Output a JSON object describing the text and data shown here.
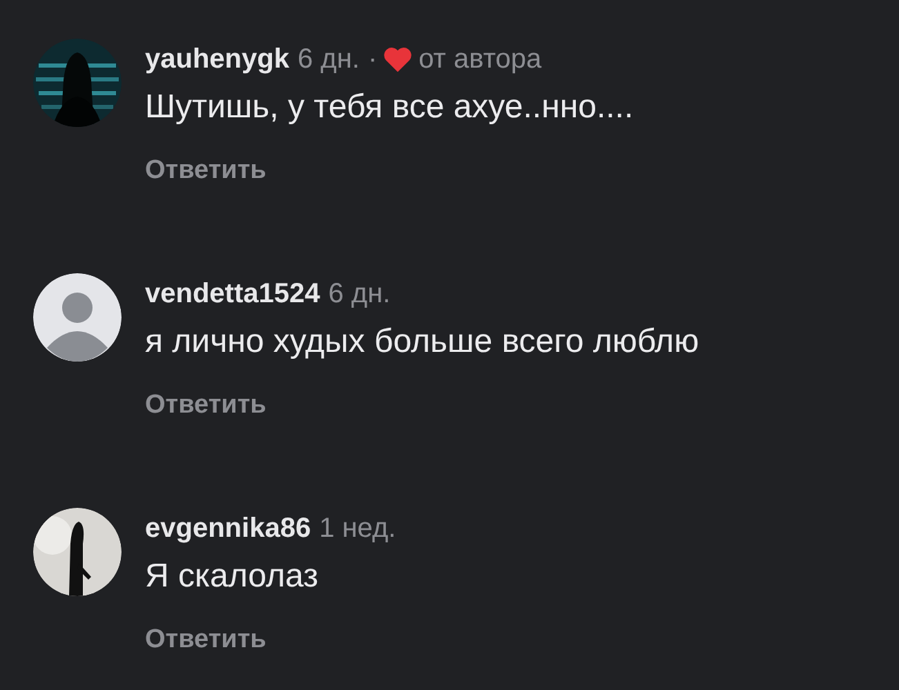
{
  "comments": [
    {
      "username": "yauhenygk",
      "time": "6 дн.",
      "liked_by_author": true,
      "separator": "·",
      "author_like_label": "от автора",
      "text": "Шутишь, у тебя все ахуе..нно....",
      "reply": "Ответить"
    },
    {
      "avatar": {
        "kind": "placeholder"
      },
      "username": "vendetta1524",
      "time": "6 дн.",
      "liked_by_author": false,
      "text": "я лично худых больше всего люблю",
      "reply": "Ответить"
    },
    {
      "username": "evgennika86",
      "time": "1 нед.",
      "liked_by_author": false,
      "text": "Я скалолаз",
      "reply": "Ответить"
    }
  ]
}
